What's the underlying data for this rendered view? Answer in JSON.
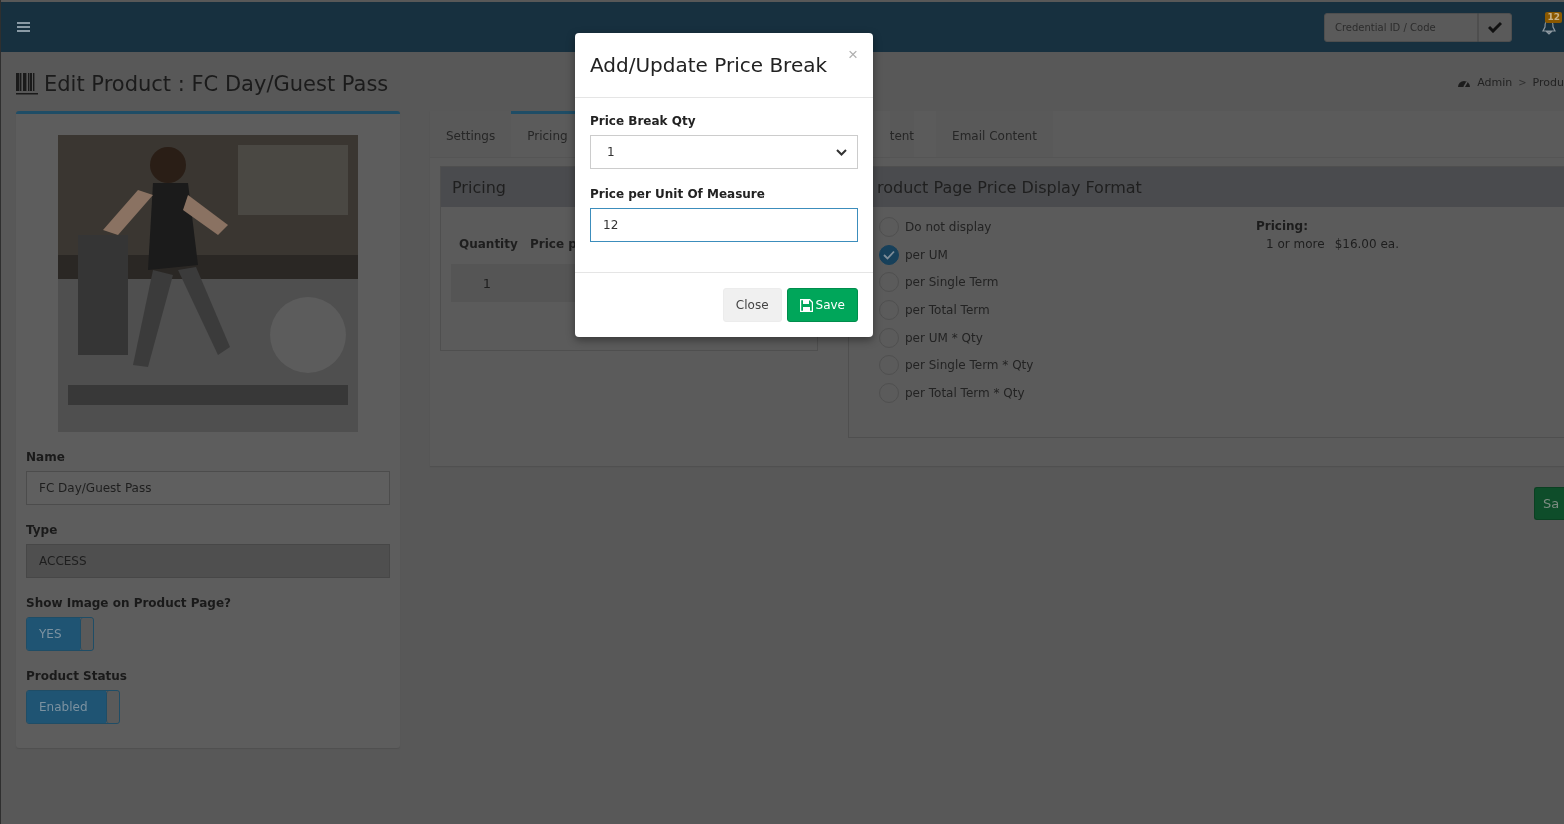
{
  "top_bar": {
    "credential_field": {
      "placeholder": "Credential ID / Code"
    },
    "notification_count": "12"
  },
  "page_title": "Edit Product : FC Day/Guest Pass",
  "breadcrumb": {
    "items": [
      "Admin",
      "Produ"
    ],
    "separator": ">"
  },
  "product_card": {
    "fields": [
      {
        "label": "Name",
        "value": "FC Day/Guest Pass",
        "disabled": false
      },
      {
        "label": "Type",
        "value": "ACCESS",
        "disabled": true
      }
    ],
    "toggles": [
      {
        "label": "Show Image on Product Page?",
        "text": "YES",
        "on": true
      },
      {
        "label": "Product Status",
        "text": "Enabled",
        "on": true
      }
    ]
  },
  "tabs": [
    {
      "label": "Settings",
      "selected": false
    },
    {
      "label": "Pricing",
      "selected": true
    },
    {
      "label": "tent",
      "selected": false
    },
    {
      "label": "Email Content",
      "selected": false
    }
  ],
  "pricing_card": {
    "title": "Pricing",
    "columns": [
      "Quantity",
      "Price p"
    ],
    "rows": [
      [
        "1"
      ]
    ]
  },
  "display_format_card": {
    "title": "roduct Page Price Display Format",
    "options": [
      {
        "label": "Do not display",
        "selected": false
      },
      {
        "label": "per UM",
        "selected": true
      },
      {
        "label": "per Single Term",
        "selected": false
      },
      {
        "label": "per Total Term",
        "selected": false
      },
      {
        "label": "per UM * Qty",
        "selected": false
      },
      {
        "label": "per Single Term * Qty",
        "selected": false
      },
      {
        "label": "per Total Term * Qty",
        "selected": false
      }
    ],
    "pricing_summary": {
      "title": "Pricing:",
      "rows": [
        [
          "1 or more",
          "$16.00 ea."
        ]
      ]
    }
  },
  "save_button": "Sa",
  "modal": {
    "title": "Add/Update Price Break",
    "close_symbol": "×",
    "fields": [
      {
        "kind": "select",
        "label": "Price Break Qty",
        "value": "1",
        "focused": false
      },
      {
        "kind": "input",
        "label": "Price per Unit Of Measure",
        "value": "12",
        "focused": true
      }
    ],
    "buttons": [
      {
        "kind": "default",
        "label": "Close"
      },
      {
        "kind": "primary",
        "label": "Save"
      }
    ]
  }
}
